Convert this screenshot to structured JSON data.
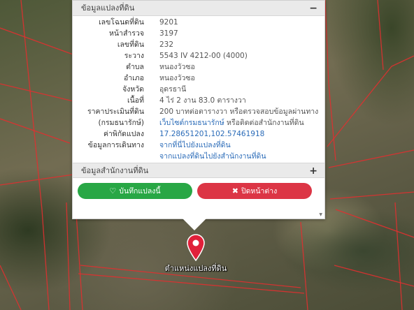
{
  "info_panel": {
    "title": "ข้อมูลแปลงที่ดิน",
    "collapse_sign": "−",
    "rows": [
      {
        "label": "เลขโฉนดที่ดิน",
        "value": "9201"
      },
      {
        "label": "หน้าสำรวจ",
        "value": "3197"
      },
      {
        "label": "เลขที่ดิน",
        "value": "232"
      },
      {
        "label": "ระวาง",
        "value": "5543 IV 4212-00 (4000)"
      },
      {
        "label": "ตำบล",
        "value": "หนองวัวซอ"
      },
      {
        "label": "อำเภอ",
        "value": "หนองวัวซอ"
      },
      {
        "label": "จังหวัด",
        "value": "อุดรธานี"
      },
      {
        "label": "เนื้อที่",
        "value": "4 ไร่ 2 งาน 83.0 ตารางวา"
      },
      {
        "label": "ราคาประเมินที่ดิน",
        "value": "200 บาทต่อตารางวา หรือตรวจสอบข้อมูลผ่านทาง"
      },
      {
        "label": "(กรมธนารักษ์)",
        "value_link": "เว็บไซต์กรมธนารักษ์",
        "value_suffix": " หรือติดต่อสำนักงานที่ดิน"
      },
      {
        "label": "ค่าพิกัดแปลง",
        "value": "17.28651201,102.57461918"
      },
      {
        "label": "ข้อมูลการเดินทาง",
        "value": "จากที่นี่ไปยังแปลงที่ดิน"
      },
      {
        "label": "",
        "value": "จากแปลงที่ดินไปยังสำนักงานที่ดิน"
      }
    ]
  },
  "office_panel": {
    "title": "ข้อมูลสำนักงานที่ดิน",
    "expand_sign": "+"
  },
  "buttons": {
    "save_label": "บันทึกแปลงนี้",
    "close_label": "ปิดหน้าต่าง"
  },
  "marker": {
    "label": "ตำแหน่งแปลงที่ดิน",
    "color": "#e0203a"
  },
  "colors": {
    "save": "#28a745",
    "close": "#dc3545",
    "link": "#2a6bb8",
    "parcel_lines": "#e03030"
  }
}
